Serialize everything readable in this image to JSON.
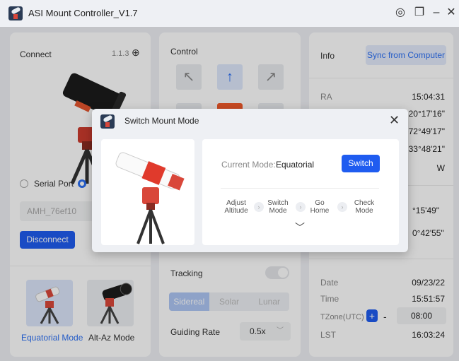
{
  "app": {
    "title": "ASI Mount Controller_V1.7"
  },
  "connect": {
    "title": "Connect",
    "version": "1.1.3",
    "radio_serial": "Serial Port",
    "device_field": "AMH_76ef10",
    "disconnect": "Disconnect",
    "modes": [
      {
        "label": "Equatorial Mode",
        "selected": true
      },
      {
        "label": "Alt-Az Mode",
        "selected": false
      }
    ]
  },
  "control": {
    "title": "Control",
    "tracking_label": "Tracking",
    "tracking_on": false,
    "rates": [
      "Sidereal",
      "Solar",
      "Lunar"
    ],
    "rate_selected": "Sidereal",
    "guiding_label": "Guiding Rate",
    "guiding_value": "0.5x"
  },
  "info": {
    "title": "Info",
    "sync_button": "Sync from Computer",
    "ra_label": "RA",
    "ra_value": "15:04:31",
    "dec_value": "+20°17'16\"",
    "alt_value": "+72°49'17\"",
    "az_value": "233°48'21\"",
    "pier_value": "W",
    "coord1_value": "°15'49\"",
    "coord2_value": "0°42'55\"",
    "date_label": "Date",
    "date_value": "09/23/22",
    "time_label": "Time",
    "time_value": "15:51:57",
    "tzone_label": "TZone(UTC)",
    "tzone_plus": "+",
    "tzone_minus": "-",
    "tzone_value": "08:00",
    "lst_label": "LST",
    "lst_value": "16:03:24"
  },
  "dialog": {
    "title": "Switch Mount Mode",
    "current_mode_label": "Current Mode:",
    "current_mode_value": "Equatorial",
    "switch_button": "Switch",
    "steps": [
      {
        "line1": "Adjust",
        "line2": "Altitude"
      },
      {
        "line1": "Switch",
        "line2": "Mode"
      },
      {
        "line1": "Go",
        "line2": "Home"
      },
      {
        "line1": "Check",
        "line2": "Mode"
      }
    ]
  },
  "colors": {
    "accent": "#1f5cf0",
    "telescope_red": "#d9473a",
    "background": "#eef0f4"
  }
}
